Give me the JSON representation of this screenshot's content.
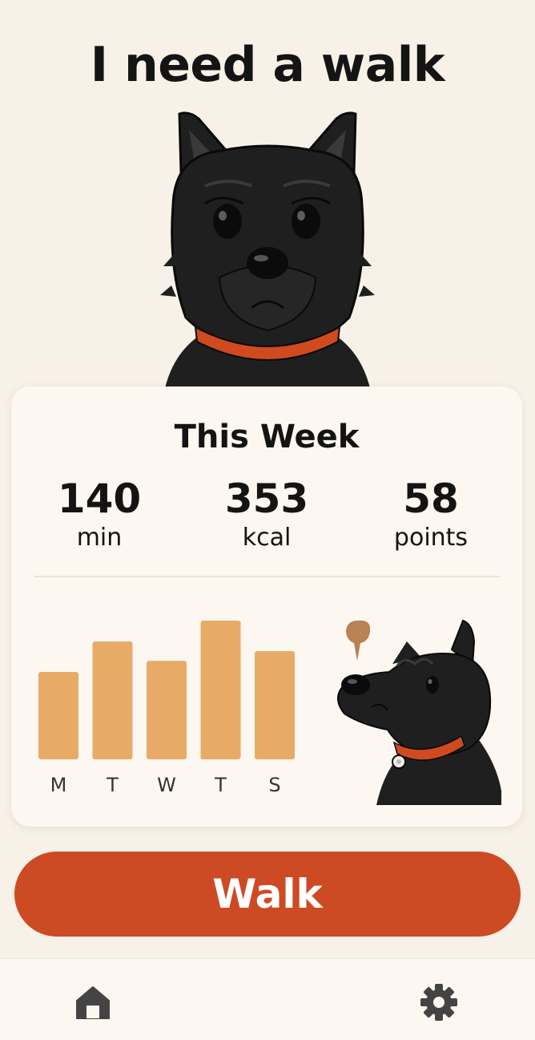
{
  "header": {
    "title": "I need a walk"
  },
  "stats_card": {
    "title": "This Week",
    "stats": [
      {
        "value": "140",
        "unit": "min"
      },
      {
        "value": "353",
        "unit": "kcal"
      },
      {
        "value": "58",
        "unit": "points"
      }
    ]
  },
  "chart_data": {
    "type": "bar",
    "categories": [
      "M",
      "T",
      "W",
      "T",
      "S"
    ],
    "values": [
      0.63,
      0.85,
      0.71,
      1.0,
      0.78
    ],
    "title": "",
    "xlabel": "",
    "ylabel": "",
    "grid": false,
    "color": "#e8ab67"
  },
  "actions": {
    "walk_label": "Walk"
  },
  "bottom_nav": {
    "items": [
      {
        "icon": "home-icon"
      },
      {
        "icon": "gear-icon"
      }
    ]
  },
  "colors": {
    "background": "#f8f1e8",
    "card": "#fcf7f0",
    "accent": "#cc4b24",
    "bar": "#e8ab67",
    "dog": "#1f1f1f",
    "collar": "#d04a1f"
  }
}
